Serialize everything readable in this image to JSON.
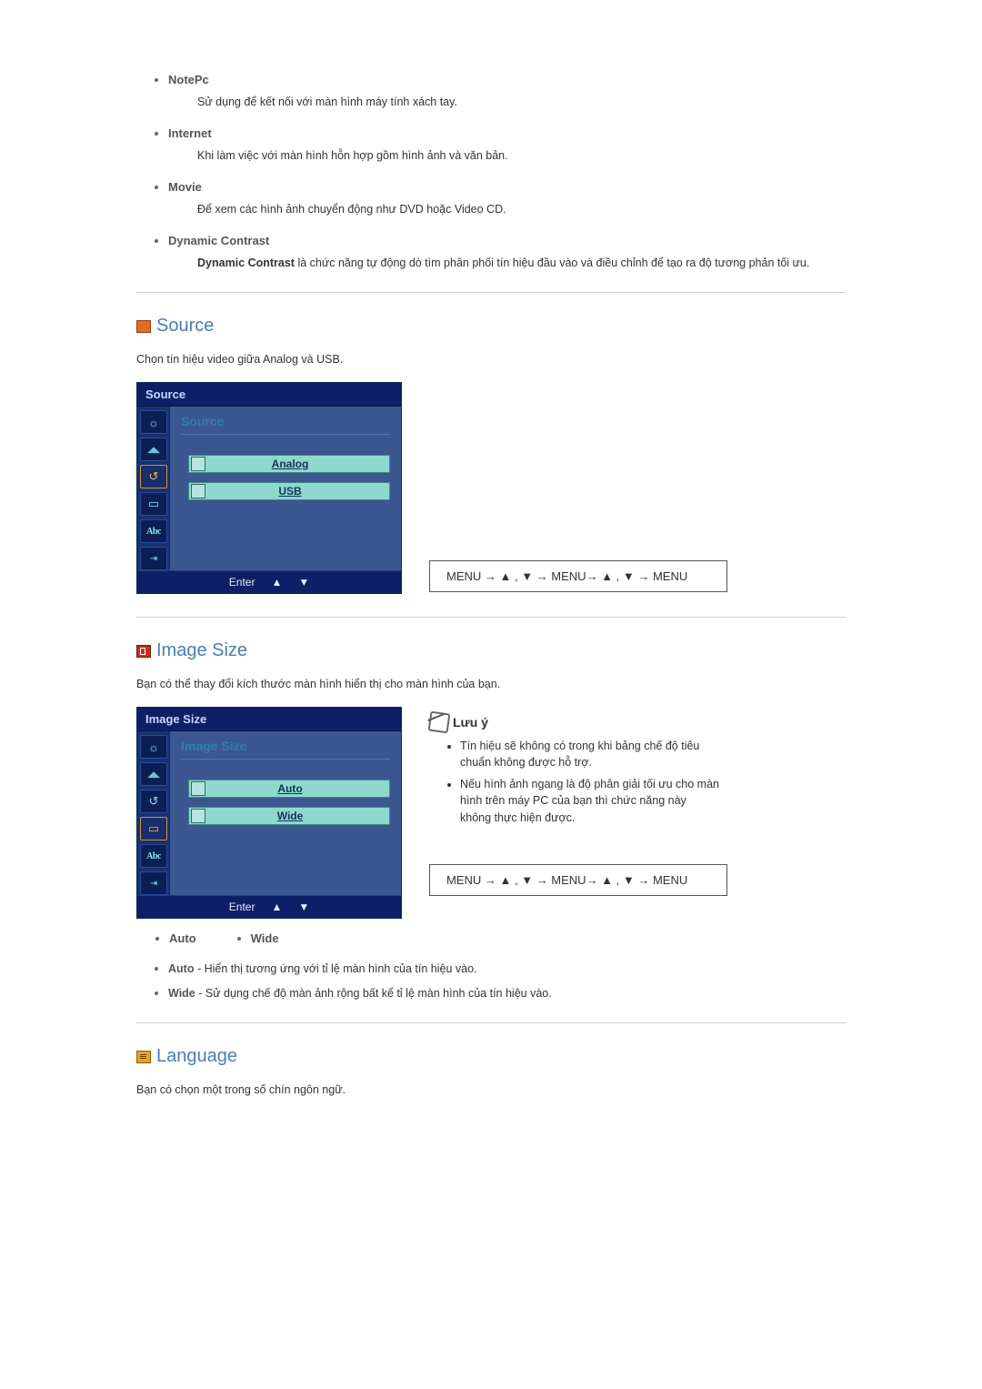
{
  "top_list": [
    {
      "title": "NotePc",
      "desc": "Sử dụng để kết nối với màn hình máy tính xách tay."
    },
    {
      "title": "Internet",
      "desc": "Khi làm việc với màn hình hỗn hợp gồm hình ảnh và văn bản."
    },
    {
      "title": "Movie",
      "desc": "Để xem các hình ảnh chuyển động như DVD hoặc Video CD."
    },
    {
      "title": "Dynamic Contrast",
      "desc_prefix": "Dynamic Contrast",
      "desc": " là chức năng tự động dò tìm phân phối tín hiệu đầu vào và điều chỉnh để tạo ra độ tương phản tối ưu."
    }
  ],
  "source": {
    "heading": "Source",
    "intro": "Chọn tín hiệu video giữa Analog và USB.",
    "panel_title": "Source",
    "subtitle": "Source",
    "options": [
      "Analog",
      "USB"
    ],
    "footer": {
      "enter": "Enter",
      "up": "▲",
      "down": "▼"
    },
    "nav": "MENU → ▲ , ▼ → MENU→ ▲ , ▼ → MENU"
  },
  "sidebar_icons": [
    {
      "name": "brightness-icon",
      "glyph": "☼"
    },
    {
      "name": "gauge-icon",
      "glyph": "◢◣"
    },
    {
      "name": "source-icon",
      "glyph": "↺"
    },
    {
      "name": "screen-icon",
      "glyph": "▭"
    },
    {
      "name": "abc-icon",
      "glyph": "Abc"
    },
    {
      "name": "exit-icon",
      "glyph": "⇥"
    }
  ],
  "imagesize": {
    "heading": "Image Size",
    "intro": "Bạn có thể thay đổi kích thước màn hình hiển thị cho màn hình của bạn.",
    "panel_title": "Image Size",
    "subtitle": "Image Size",
    "options": [
      "Auto",
      "Wide"
    ],
    "footer": {
      "enter": "Enter",
      "up": "▲",
      "down": "▼"
    },
    "note_title": "Lưu ý",
    "notes": [
      "Tín hiệu sẽ không có trong khi bảng chế độ tiêu chuẩn không được hỗ trợ.",
      "Nếu hình ảnh ngang là độ phân giải tối ưu cho màn hình trên máy PC của bạn thì chức năng này không thực hiện được."
    ],
    "nav": "MENU → ▲ , ▼ → MENU→ ▲ , ▼ → MENU",
    "inline_opts": [
      "Auto",
      "Wide"
    ],
    "opt_desc": [
      {
        "bold": "Auto",
        "text": " - Hiển thị tương ứng với tỉ lệ màn hình của tín hiệu vào."
      },
      {
        "bold": "Wide",
        "text": " - Sử dụng chế độ màn ảnh rộng bất kể tỉ lệ màn hình của tín hiệu vào."
      }
    ]
  },
  "language": {
    "heading": "Language",
    "intro": "Bạn có chọn một trong số chín ngôn ngữ."
  }
}
